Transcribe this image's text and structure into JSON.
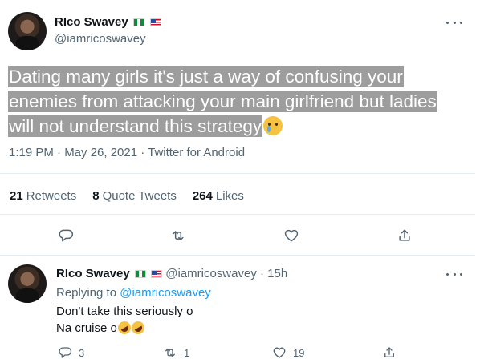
{
  "tweet": {
    "author_name": "RIco Swavey",
    "author_handle": "@iamricoswavey",
    "flags": [
      "nigeria-flag",
      "us-flag"
    ],
    "text_line1": "Dating many girls it's just a way of confusing your",
    "text_line2": "enemies from attacking your main girlfriend but ladies",
    "text_line3": "will not understand this strategy",
    "text_emoji": "crying-face-emoji",
    "meta": "1:19 PM · May 26, 2021 · Twitter for Android",
    "stats": {
      "retweets_count": "21",
      "retweets_label": "Retweets",
      "quotes_count": "8",
      "quotes_label": "Quote Tweets",
      "likes_count": "264",
      "likes_label": "Likes"
    },
    "actions": [
      "reply-icon",
      "retweet-icon",
      "like-icon",
      "share-icon"
    ]
  },
  "reply": {
    "author_name": "RIco Swavey",
    "author_handle": "@iamricoswavey",
    "time": "· 15h",
    "replying_label": "Replying to",
    "replying_handle": "@iamricoswavey",
    "line1": "Don't take this seriously o",
    "line2": "Na cruise o",
    "line2_emoji": "rolling-on-floor-laughing-emoji",
    "reply_count": "3",
    "retweet_count": "1",
    "like_count": "19"
  },
  "colors": {
    "text": "#0f1419",
    "secondary": "#536471",
    "link": "#1d9bf0",
    "highlight": "#9d9d9d",
    "divider": "#e6ecf0"
  }
}
